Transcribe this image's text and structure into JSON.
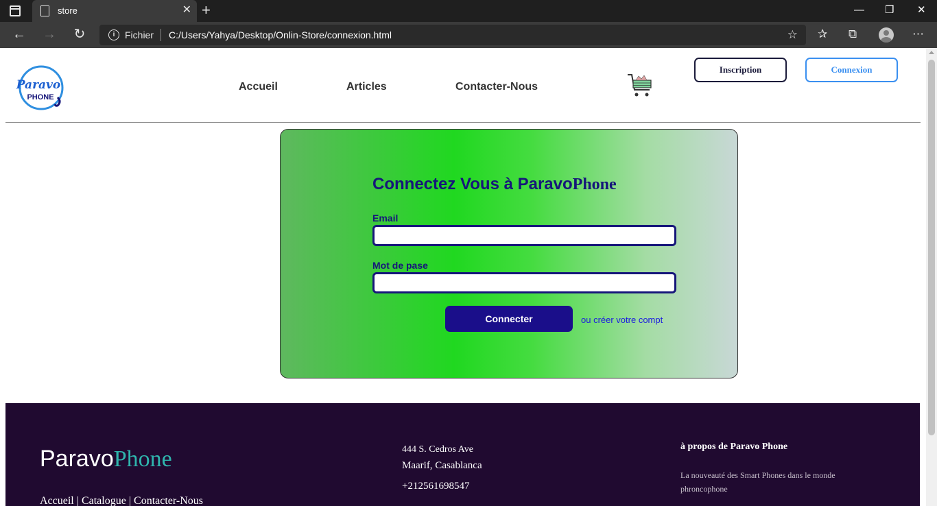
{
  "browser": {
    "tab_title": "store",
    "address_scheme": "Fichier",
    "address_url": "C:/Users/Yahya/Desktop/Onlin-Store/connexion.html"
  },
  "header": {
    "logo_alt_word": "Paravo",
    "logo_alt_word2": "PHONE",
    "nav": [
      "Accueil",
      "Articles",
      "Contacter-Nous"
    ],
    "inscription_label": "Inscription",
    "connexion_label": "Connexion"
  },
  "login": {
    "title_part1": "Connectez Vous à Paravo",
    "title_part2": "Phone",
    "email_label": "Email",
    "email_value": "",
    "password_label": "Mot de pase",
    "password_value": "",
    "connect_button": "Connecter",
    "create_link": "ou créer votre compt"
  },
  "footer": {
    "brand_part1": "Paravo",
    "brand_part2": "Phone",
    "links": [
      "Accueil",
      "Catalogue",
      "Contacter-Nous"
    ],
    "link_separator": "|",
    "address_line1": "444 S. Cedros Ave",
    "address_line2": "Maarif, Casablanca",
    "phone": "+212561698547",
    "about_title": "à propos de Paravo Phone",
    "about_text": "La nouveauté des Smart Phones dans le monde phroncophone"
  },
  "colors": {
    "primary_navy": "#16167a",
    "connect_button": "#1a0e8a",
    "connexion_accent": "#3a8ff0",
    "footer_bg": "#200a30",
    "footer_accent": "#2fb5ad"
  }
}
